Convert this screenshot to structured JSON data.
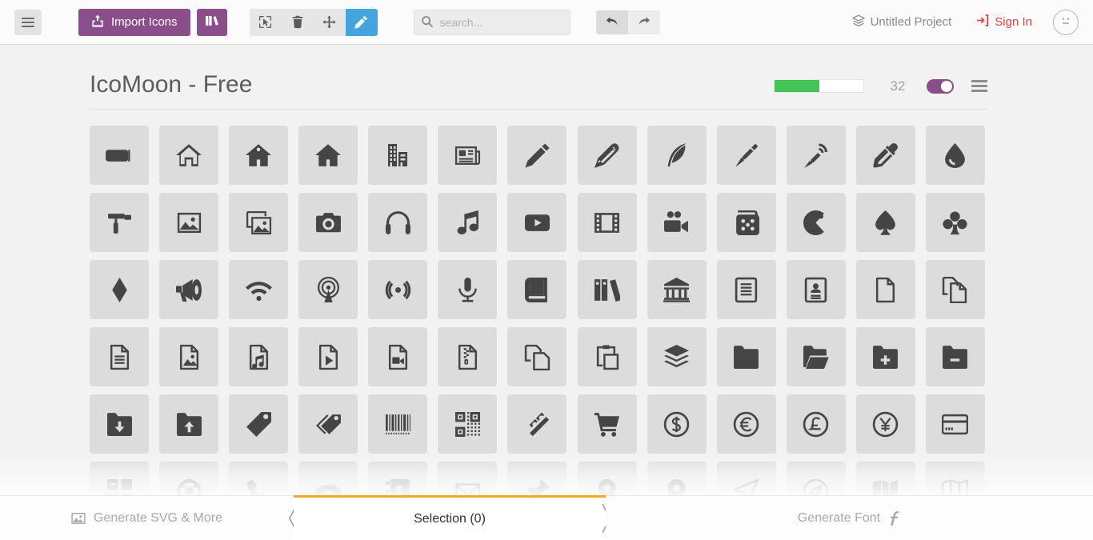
{
  "toolbar": {
    "menu_icon": "hamburger-icon",
    "import_label": "Import Icons",
    "import_icon": "upload-box-icon",
    "library_icon": "books-icon",
    "tools": [
      {
        "name": "select-tool",
        "icon": "cursor-select-icon",
        "active": false
      },
      {
        "name": "delete-tool",
        "icon": "trash-icon",
        "active": false
      },
      {
        "name": "move-tool",
        "icon": "move-arrows-icon",
        "active": false
      },
      {
        "name": "edit-tool",
        "icon": "pencil-icon",
        "active": true
      }
    ],
    "search": {
      "placeholder": "search...",
      "value": "",
      "icon": "search-icon"
    },
    "undo_icon": "undo-arrow-icon",
    "redo_icon": "redo-arrow-icon",
    "project_name": "Untitled Project",
    "project_icon": "layers-icon",
    "sign_in_label": "Sign In",
    "sign_in_icon": "login-icon",
    "avatar_icon": "neutral-face-icon"
  },
  "set": {
    "title": "IcoMoon - Free",
    "progress_percent": 50,
    "count": "32",
    "toggle_on": true,
    "menu_icon": "set-menu-icon"
  },
  "colors": {
    "brand_purple": "#8a4f8a",
    "accent_blue": "#45a3e0",
    "progress_green": "#43c457",
    "sign_in_red": "#e2403a",
    "active_tab_orange": "#f5a623",
    "icon_cell_bg": "#dcdcdc",
    "page_bg": "#f2f2f2"
  },
  "grid": {
    "rows": [
      [
        "tab-icon",
        "home-icon",
        "home2-icon",
        "home3-icon",
        "office-icon",
        "newspaper-icon",
        "pencil-icon",
        "pencil2-icon",
        "quill-icon",
        "pen-icon",
        "blog-icon",
        "eyedropper-icon",
        "droplet-icon"
      ],
      [
        "paint-format-icon",
        "image-icon",
        "images-icon",
        "camera-icon",
        "headphones-icon",
        "music-icon",
        "play-icon",
        "film-icon",
        "video-camera-icon",
        "dice-icon",
        "pacman-icon",
        "spades-icon",
        "clubs-icon"
      ],
      [
        "diamonds-icon",
        "bullhorn-icon",
        "connection-icon",
        "podcast-icon",
        "feed-icon",
        "mic-icon",
        "book-icon",
        "books-icon",
        "library-icon",
        "file-text-icon",
        "profile-icon",
        "file-empty-icon",
        "files-empty-icon"
      ],
      [
        "file-text2-icon",
        "file-picture-icon",
        "file-music-icon",
        "file-play-icon",
        "file-video-icon",
        "file-zip-icon",
        "copy-icon",
        "paste-icon",
        "stack-icon",
        "folder-icon",
        "folder-open-icon",
        "folder-plus-icon",
        "folder-minus-icon"
      ],
      [
        "folder-download-icon",
        "folder-upload-icon",
        "price-tag-icon",
        "price-tags-icon",
        "barcode-icon",
        "qrcode-icon",
        "ticket-icon",
        "cart-icon",
        "coin-dollar-icon",
        "coin-euro-icon",
        "coin-pound-icon",
        "coin-yen-icon",
        "credit-card-icon"
      ],
      [
        "calculator-icon",
        "lifebuoy-icon",
        "phone-icon",
        "phone-hang-up-icon",
        "address-book-icon",
        "envelop-icon",
        "pushpin-icon",
        "location-icon",
        "location2-icon",
        "compass-icon",
        "compass2-icon",
        "map-icon",
        "map2-icon"
      ]
    ]
  },
  "bottom": {
    "generate_svg_label": "Generate SVG & More",
    "generate_svg_icon": "image-icon",
    "selection_label": "Selection (0)",
    "generate_font_label": "Generate Font",
    "generate_font_icon": "font-f-icon",
    "prev_icon": "chevron-left-icon",
    "next_icon": "chevron-right-icon"
  }
}
